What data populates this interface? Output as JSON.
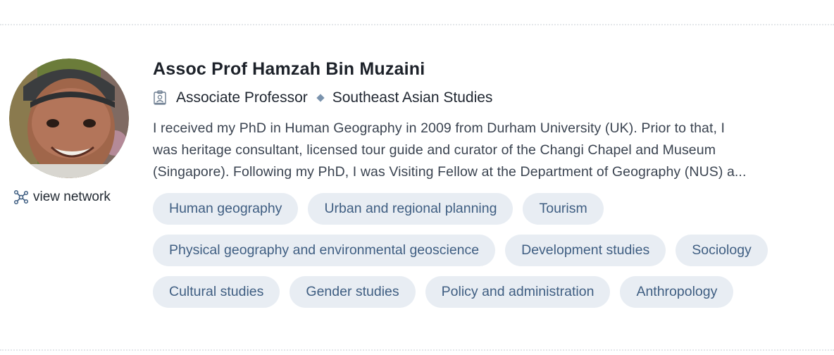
{
  "profile": {
    "name": "Assoc Prof Hamzah Bin Muzaini",
    "position": "Associate Professor",
    "department": "Southeast Asian Studies",
    "bio_lines": [
      "I received my PhD in Human Geography in 2009 from Durham University (UK). Prior to that, I",
      "was heritage consultant, licensed tour guide and curator of the Changi Chapel and Museum",
      "(Singapore). Following my PhD, I was Visiting Fellow at the Department of Geography (NUS) a..."
    ],
    "view_network_label": "view network",
    "avatar_icon": "avatar-photo",
    "position_icon": "id-badge-icon",
    "network_icon": "network-icon"
  },
  "tags": {
    "row1": [
      "Human geography",
      "Urban and regional planning",
      "Tourism"
    ],
    "row2": [
      "Physical geography and environmental geoscience",
      "Development studies",
      "Sociology"
    ],
    "row3": [
      "Cultural studies",
      "Gender studies",
      "Policy and administration",
      "Anthropology"
    ]
  },
  "colors": {
    "tag_background": "#e8edf3",
    "tag_text": "#3f5e82",
    "separator": "#7a93ad"
  }
}
